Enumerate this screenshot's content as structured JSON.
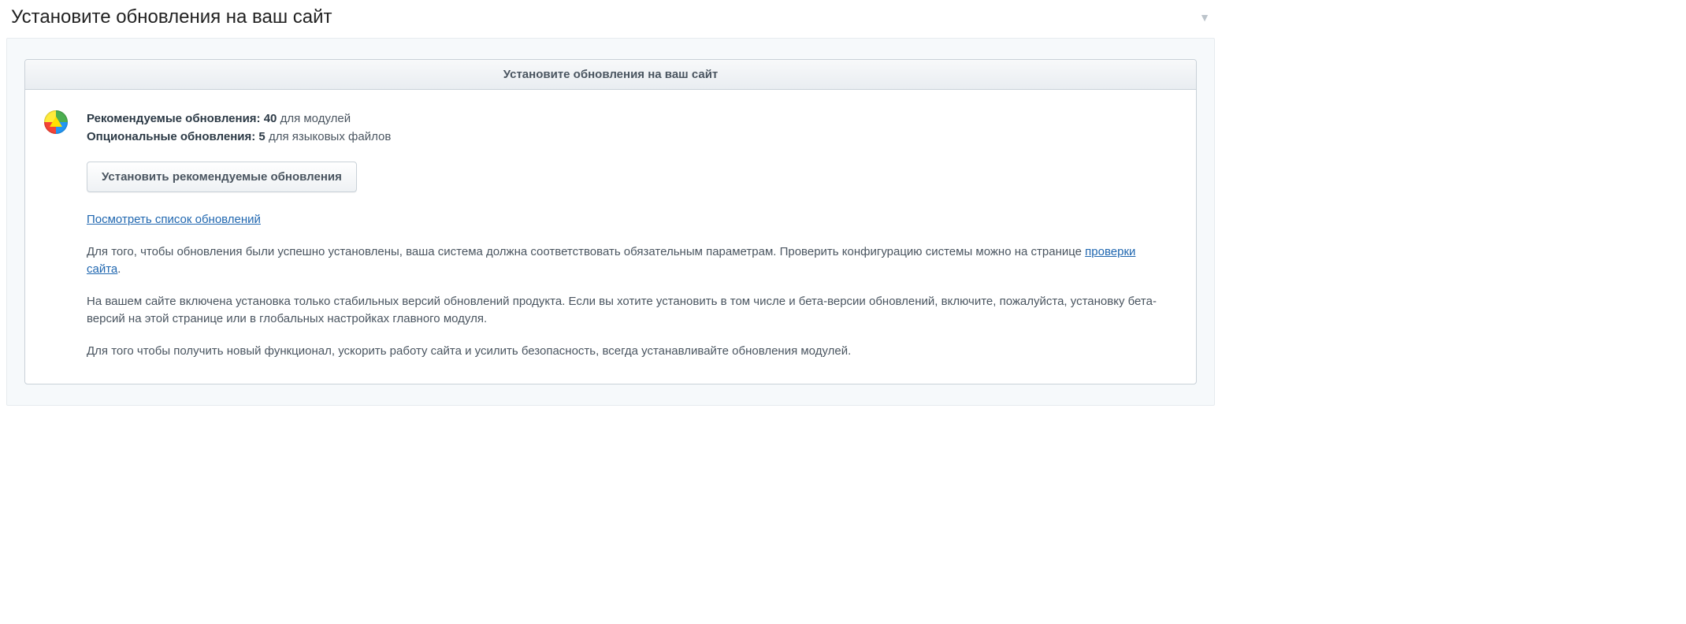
{
  "page_title": "Установите обновления на ваш сайт",
  "panel": {
    "header": "Установите обновления на ваш сайт",
    "updates": {
      "recommended_label": "Рекомендуемые обновления:",
      "recommended_count": "40",
      "recommended_suffix": "для модулей",
      "optional_label": "Опциональные обновления:",
      "optional_count": "5",
      "optional_suffix": "для языковых файлов"
    },
    "install_button": "Установить рекомендуемые обновления",
    "view_list_link": "Посмотреть список обновлений",
    "para1_a": "Для того, чтобы обновления были успешно установлены, ваша система должна соответствовать обязательным параметрам. Проверить конфигурацию системы можно на странице ",
    "para1_link": "проверки сайта",
    "para1_b": ".",
    "para2": "На вашем сайте включена установка только стабильных версий обновлений продукта. Если вы хотите установить в том числе и бета-версии обновлений, включите, пожалуйста, установку бета-версий на этой странице или в глобальных настройках главного модуля.",
    "para3": "Для того чтобы получить новый функционал, ускорить работу сайта и усилить безопасность, всегда устанавливайте обновления модулей."
  }
}
